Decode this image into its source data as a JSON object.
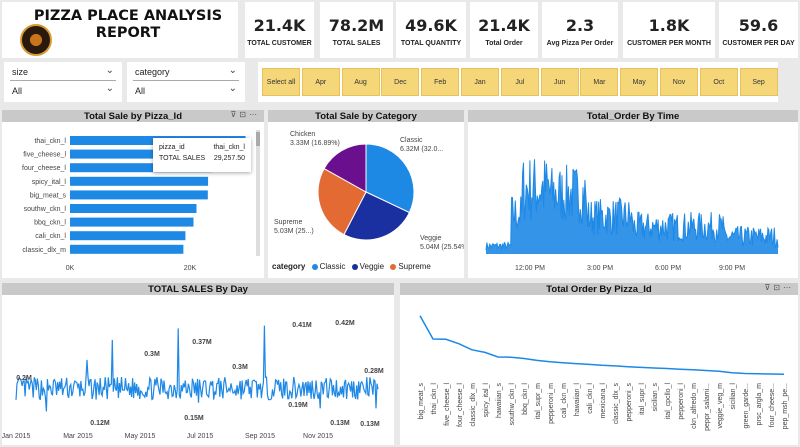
{
  "report": {
    "title": "PIZZA PLACE ANALYSIS REPORT",
    "logo_icon": "pizza-logo-icon"
  },
  "kpis": [
    {
      "value": "21.4K",
      "label": "TOTAL CUSTOMER"
    },
    {
      "value": "78.2M",
      "label": "TOTAL SALES"
    },
    {
      "value": "49.6K",
      "label": "TOTAL QUANTITY"
    },
    {
      "value": "21.4K",
      "label": "Total Order"
    },
    {
      "value": "2.3",
      "label": "Avg Pizza Per Order"
    },
    {
      "value": "1.8K",
      "label": "CUSTOMER PER MONTH"
    },
    {
      "value": "59.6",
      "label": "CUSTOMER PER DAY"
    }
  ],
  "slicers": {
    "size": {
      "title": "size",
      "value": "All"
    },
    "category": {
      "title": "category",
      "value": "All"
    }
  },
  "months": [
    "Select all",
    "Apr",
    "Aug",
    "Dec",
    "Feb",
    "Jan",
    "Jul",
    "Jun",
    "Mar",
    "May",
    "Nov",
    "Oct",
    "Sep"
  ],
  "tooltip": {
    "k1": "pizza_id",
    "v1": "thai_ckn_l",
    "k2": "TOTAL SALES",
    "v2": "29,257.50"
  },
  "legend": {
    "title": "category",
    "items": [
      "Classic",
      "Veggie",
      "Supreme"
    ]
  },
  "colors": {
    "accent": "#1e88e5",
    "veggie": "#1a2fa0",
    "supreme": "#e46a34",
    "chicken": "#6a0f8e",
    "slicer_button": "#f5d77a"
  },
  "chart_data": [
    {
      "type": "bar",
      "title": "Total Sale by Pizza_Id",
      "categories": [
        "thai_ckn_l",
        "five_cheese_l",
        "four_cheese_l",
        "spicy_ital_l",
        "big_meat_s",
        "southw_ckn_l",
        "bbq_ckn_l",
        "cali_ckn_l",
        "classic_dlx_m"
      ],
      "values": [
        29257.5,
        26066.5,
        23622.2,
        23011.8,
        22968,
        21082,
        20584,
        19235.25,
        18896.5
      ],
      "xticks": [
        "0K",
        "20K"
      ],
      "xlim": [
        0,
        30000
      ]
    },
    {
      "type": "pie",
      "title": "Total Sale by Category",
      "slices": [
        {
          "name": "Classic",
          "value": 6.32,
          "label": "Classic 6.32M (32.0...",
          "color": "#1e88e5"
        },
        {
          "name": "Veggie",
          "value": 5.04,
          "label": "Veggie 5.04M (25.54%)",
          "color": "#1a2fa0"
        },
        {
          "name": "Supreme",
          "value": 5.03,
          "label": "Supreme 5.03M (25...)",
          "color": "#e46a34"
        },
        {
          "name": "Chicken",
          "value": 3.33,
          "label": "Chicken 3.33M (16.89%)",
          "color": "#6a0f8e"
        }
      ]
    },
    {
      "type": "area",
      "title": "Total_Order By Time",
      "xticks": [
        "12:00 PM",
        "3:00 PM",
        "6:00 PM",
        "9:00 PM"
      ],
      "seed": 7,
      "points": 320
    },
    {
      "type": "line",
      "title": "TOTAL SALES By Day",
      "xticks": [
        "Jan 2015",
        "Mar 2015",
        "May 2015",
        "Jul 2015",
        "Sep 2015",
        "Nov 2015"
      ],
      "annotations": [
        "0.2M",
        "0.12M",
        "0.3M",
        "0.37M",
        "0.15M",
        "0.3M",
        "0.41M",
        "0.19M",
        "0.42M",
        "0.13M",
        "0.28M",
        "0.13M"
      ],
      "ylim": [
        0.1,
        0.45
      ],
      "seed": 13,
      "points": 358
    },
    {
      "type": "line",
      "title": "Total Order By Pizza_Id",
      "categories": [
        "big_meat_s",
        "thai_ckn_l",
        "five_cheese_l",
        "four_cheese_l",
        "classic_dlx_m",
        "spicy_ital_l",
        "hawaiian_s",
        "southw_ckn_l",
        "bbq_ckn_l",
        "ital_supr_m",
        "pepperoni_m",
        "cali_ckn_m",
        "hawaiian_l",
        "cali_ckn_l",
        "mexicana_l",
        "classic_dlx_s",
        "pepperoni_s",
        "ital_supr_l",
        "sicilian_s",
        "ital_cpcllo_l",
        "pepperoni_l",
        "ckn_alfredo_m",
        "peppr_salami...",
        "veggie_veg_m",
        "sicilian_l",
        "green_garde...",
        "prsc_argla_m",
        "four_cheese...",
        "pep_msh_pe..."
      ],
      "values": [
        1811,
        1365,
        1359,
        1273,
        1159,
        1109,
        1020,
        1016,
        992,
        956,
        929,
        911,
        895,
        880,
        862,
        850,
        835,
        822,
        810,
        800,
        788,
        775,
        762,
        750,
        720,
        705,
        700,
        696,
        690
      ]
    }
  ]
}
